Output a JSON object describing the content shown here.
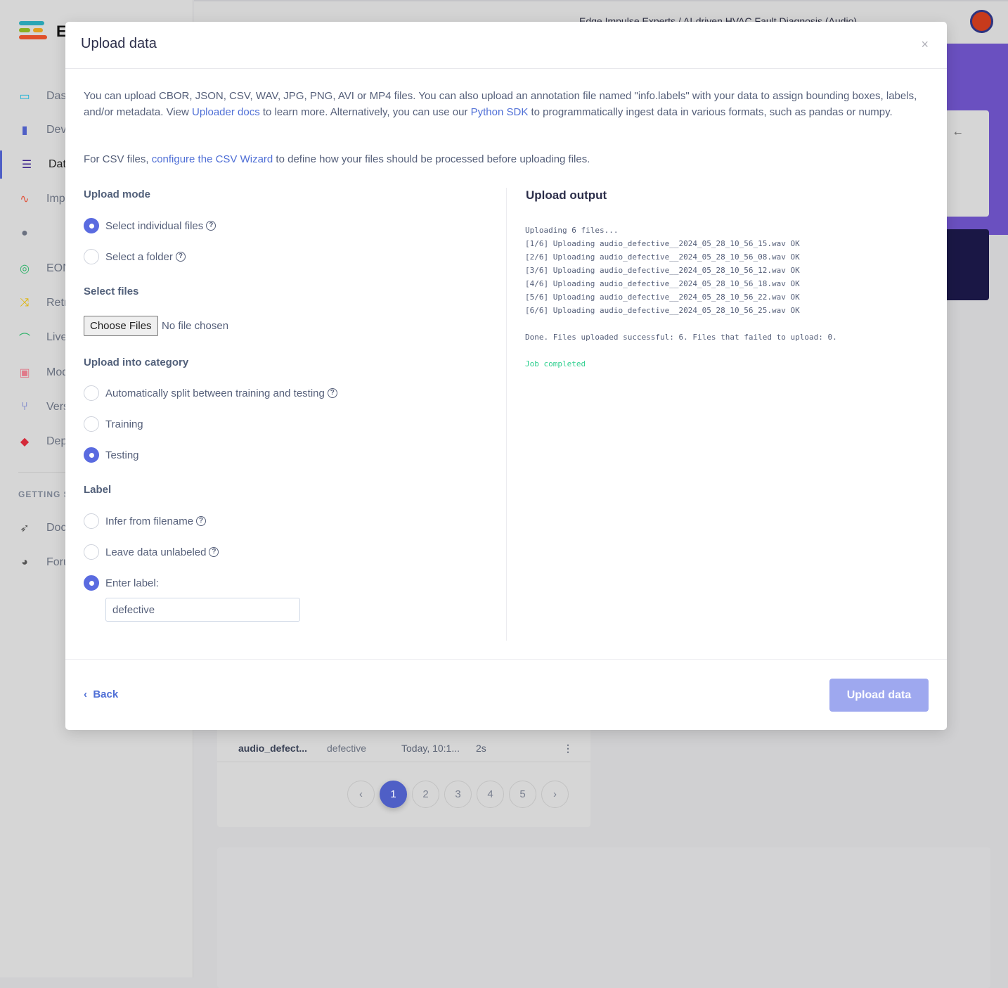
{
  "background": {
    "brand": "E",
    "breadcrumb": "Edge Impulse Experts  /  AI-driven HVAC Fault Diagnosis (Audio)",
    "sidebar": [
      {
        "label": "Dashboard",
        "icon": "monitor-icon",
        "color": "#1fb3d6"
      },
      {
        "label": "Devices",
        "icon": "chip-icon",
        "color": "#4f5fc6"
      },
      {
        "label": "Data acquisition",
        "icon": "database-icon",
        "color": "#3a1f8a",
        "active": true
      },
      {
        "label": "Impulse design",
        "icon": "pulse-icon",
        "color": "#e0523a"
      },
      {
        "label": "",
        "icon": "dot-icon",
        "color": "#6a7180"
      },
      {
        "label": "EON Tuner",
        "icon": "compass-icon",
        "color": "#2fb36a"
      },
      {
        "label": "Retrain model",
        "icon": "shuffle-icon",
        "color": "#e0b400"
      },
      {
        "label": "Live classification",
        "icon": "bezier-icon",
        "color": "#2fb36a"
      },
      {
        "label": "Model testing",
        "icon": "clipboard-check-icon",
        "color": "#e07a8a"
      },
      {
        "label": "Versioning",
        "icon": "branch-icon",
        "color": "#4f5fc6"
      },
      {
        "label": "Deployment",
        "icon": "cube-icon",
        "color": "#d42a3a"
      }
    ],
    "section": "GETTING STARTED",
    "help": [
      {
        "label": "Documentation",
        "icon": "rocket-icon"
      },
      {
        "label": "Forums",
        "icon": "chat-icon"
      }
    ],
    "table_row": {
      "name": "audio_defect...",
      "label": "defective",
      "added": "Today, 10:1...",
      "length": "2s"
    },
    "pages": [
      "1",
      "2",
      "3",
      "4",
      "5"
    ]
  },
  "modal": {
    "title": "Upload data",
    "intro_1": "You can upload CBOR, JSON, CSV, WAV, JPG, PNG, AVI or MP4 files. You can also upload an annotation file named \"info.labels\" with your data to assign bounding boxes, labels, and/or metadata. View ",
    "link_docs": "Uploader docs",
    "intro_2": " to learn more. Alternatively, you can use our ",
    "link_sdk": "Python SDK",
    "intro_3": " to programmatically ingest data in various formats, such as pandas or numpy.",
    "csv_1": "For CSV files, ",
    "csv_link": "configure the CSV Wizard",
    "csv_2": " to define how your files should be processed before uploading files.",
    "upload_mode": {
      "heading": "Upload mode",
      "options": [
        {
          "label": "Select individual files",
          "checked": true
        },
        {
          "label": "Select a folder",
          "checked": false
        }
      ]
    },
    "select_files": {
      "heading": "Select files",
      "button": "Choose Files",
      "status": "No file chosen"
    },
    "category": {
      "heading": "Upload into category",
      "options": [
        {
          "label": "Automatically split between training and testing",
          "checked": false
        },
        {
          "label": "Training",
          "checked": false
        },
        {
          "label": "Testing",
          "checked": true
        }
      ]
    },
    "label": {
      "heading": "Label",
      "options": [
        {
          "label": "Infer from filename",
          "checked": false
        },
        {
          "label": "Leave data unlabeled",
          "checked": false
        },
        {
          "label": "Enter label:",
          "checked": true
        }
      ],
      "value": "defective"
    },
    "output": {
      "heading": "Upload output",
      "lines": [
        "Uploading 6 files...",
        "[1/6] Uploading audio_defective__2024_05_28_10_56_15.wav OK",
        "[2/6] Uploading audio_defective__2024_05_28_10_56_08.wav OK",
        "[3/6] Uploading audio_defective__2024_05_28_10_56_12.wav OK",
        "[4/6] Uploading audio_defective__2024_05_28_10_56_18.wav OK",
        "[5/6] Uploading audio_defective__2024_05_28_10_56_22.wav OK",
        "[6/6] Uploading audio_defective__2024_05_28_10_56_25.wav OK",
        "",
        "Done. Files uploaded successful: 6. Files that failed to upload: 0.",
        ""
      ],
      "status": "Job completed",
      "status_color": "#2fcf8f"
    },
    "back": "Back",
    "submit": "Upload data"
  }
}
